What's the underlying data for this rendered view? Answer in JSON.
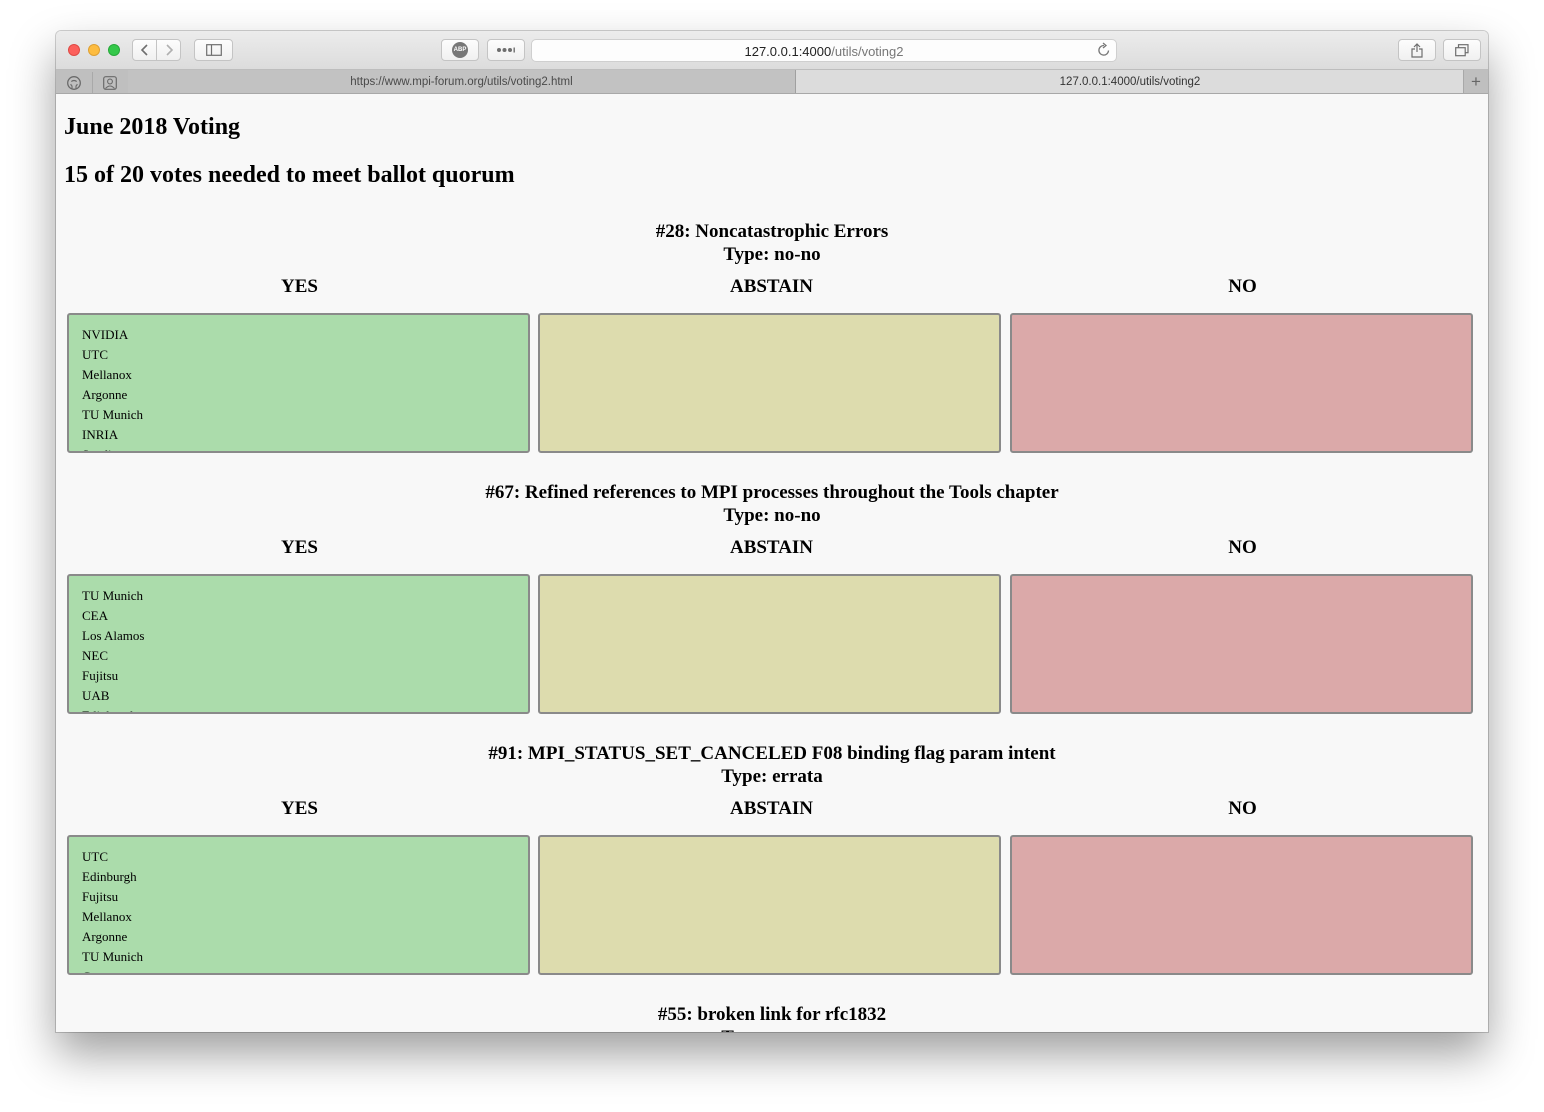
{
  "browser": {
    "url_host": "127.0.0.1:4000",
    "url_path": "/utils/voting2",
    "tabs": [
      {
        "title": "https://www.mpi-forum.org/utils/voting2.html",
        "active": false
      },
      {
        "title": "127.0.0.1:4000/utils/voting2",
        "active": true
      }
    ],
    "icons": {
      "back": "chevron-left-icon",
      "forward": "chevron-right-icon",
      "sidebar": "sidebar-icon",
      "adblock": "abp-icon",
      "adblock_label": "ABP",
      "extensions": "more-icon",
      "reload": "reload-icon",
      "share": "share-icon",
      "tabs": "tab-overview-icon",
      "github": "github-icon",
      "incognito": "person-icon",
      "add_tab": "plus-icon"
    },
    "add_tab_label": "+"
  },
  "page": {
    "title": "June 2018 Voting",
    "quorum": "15 of 20 votes needed to meet ballot quorum",
    "column_labels": {
      "yes": "YES",
      "abstain": "ABSTAIN",
      "no": "NO"
    },
    "ballots": [
      {
        "heading": "#28: Noncatastrophic Errors",
        "type": "Type: no-no",
        "yes": [
          "NVIDIA",
          "UTC",
          "Mellanox",
          "Argonne",
          "TU Munich",
          "INRIA",
          "Sandia"
        ],
        "abstain": [],
        "no": []
      },
      {
        "heading": "#67: Refined references to MPI processes throughout the Tools chapter",
        "type": "Type: no-no",
        "yes": [
          "TU Munich",
          "CEA",
          "Los Alamos",
          "NEC",
          "Fujitsu",
          "UAB",
          "Edinburgh"
        ],
        "abstain": [],
        "no": []
      },
      {
        "heading": "#91: MPI_STATUS_SET_CANCELED F08 binding flag param intent",
        "type": "Type: errata",
        "yes": [
          "UTC",
          "Edinburgh",
          "Fujitsu",
          "Mellanox",
          "Argonne",
          "TU Munich",
          "Cray"
        ],
        "abstain": [],
        "no": []
      },
      {
        "heading": "#55: broken link for rfc1832",
        "type": "Type: errata",
        "yes": [],
        "abstain": [],
        "no": []
      }
    ]
  },
  "colors": {
    "yes": "#abdcab",
    "abstain": "#dddcae",
    "no": "#dba9a9"
  }
}
